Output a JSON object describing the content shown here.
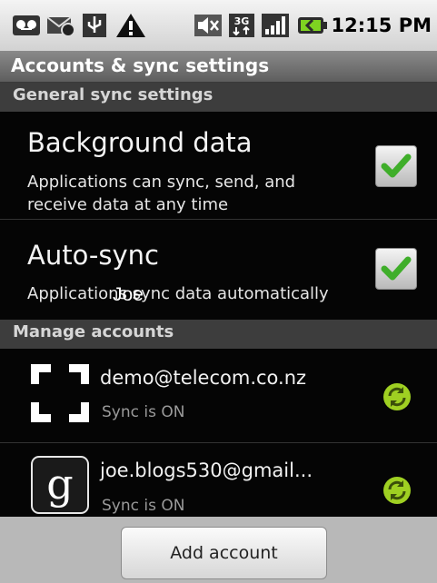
{
  "status_bar": {
    "time": "12:15 PM",
    "icons": [
      "voicemail-icon",
      "missed-call-icon",
      "usb-icon",
      "warning-icon",
      "muted-icon",
      "3g-icon",
      "signal-icon",
      "battery-icon"
    ]
  },
  "title": "Accounts & sync settings",
  "general": {
    "header": "General sync settings",
    "background_data": {
      "title": "Background data",
      "summary_line1": "Applications can sync, send, and",
      "summary_line2": "receive data at any time",
      "checked": true
    },
    "auto_sync": {
      "title": "Auto-sync",
      "summary": "Applications sync data automatically",
      "checked": true
    }
  },
  "manage": {
    "header": "Manage accounts",
    "accounts": [
      {
        "name": "demo@telecom.co.nz",
        "status": "Sync is ON",
        "icon": "corporate-account-icon"
      },
      {
        "name": "joe.blogs530@gmail...",
        "status": "Sync is ON",
        "icon": "google-account-icon"
      }
    ]
  },
  "overlay_text": "Joe",
  "add_account_label": "Add account",
  "colors": {
    "check_green": "#3fae2a",
    "sync_green": "#9fd022"
  }
}
